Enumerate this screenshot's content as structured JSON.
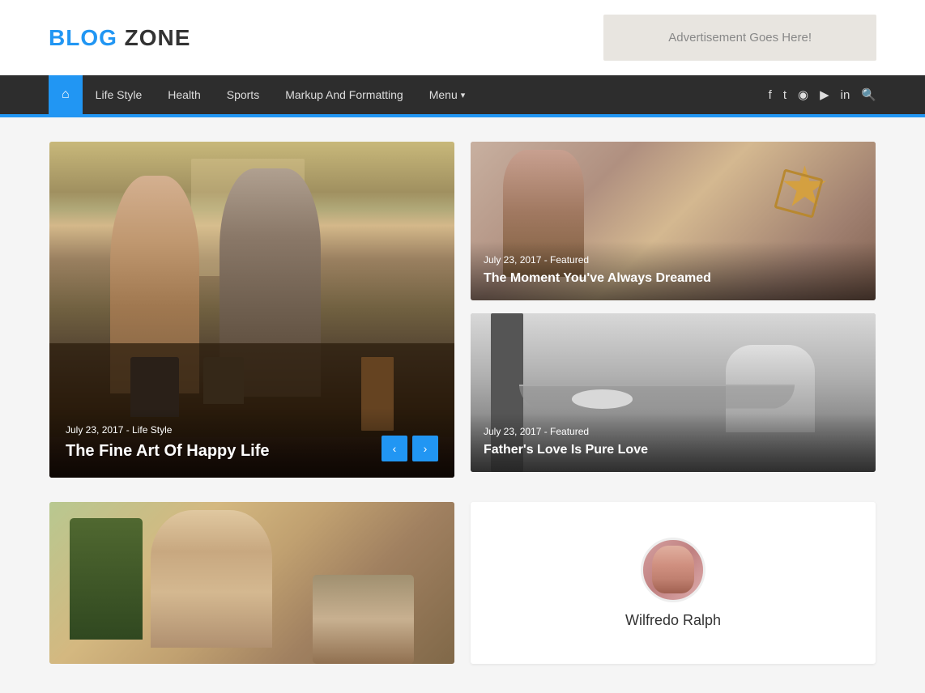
{
  "header": {
    "logo_blue": "BLOG",
    "logo_dark": " ZONE",
    "ad_text": "Advertisement Goes Here!"
  },
  "nav": {
    "home_icon": "⌂",
    "items": [
      {
        "label": "Life Style",
        "id": "lifestyle"
      },
      {
        "label": "Health",
        "id": "health"
      },
      {
        "label": "Sports",
        "id": "sports"
      },
      {
        "label": "Markup And Formatting",
        "id": "markup"
      },
      {
        "label": "Menu",
        "id": "menu"
      }
    ],
    "social_icons": [
      "f",
      "t",
      "i",
      "▶",
      "in",
      "🔍"
    ]
  },
  "featured_post": {
    "meta": "July 23, 2017 - Life Style",
    "title": "The Fine Art Of Happy Life",
    "prev_label": "‹",
    "next_label": "›"
  },
  "right_posts": [
    {
      "meta": "July 23, 2017 - Featured",
      "title": "The Moment You've Always Dreamed"
    },
    {
      "meta": "July 23, 2017 - Featured",
      "title": "Father's Love Is Pure Love"
    }
  ],
  "bottom_right": {
    "author_name": "Wilfredo Ralph"
  }
}
